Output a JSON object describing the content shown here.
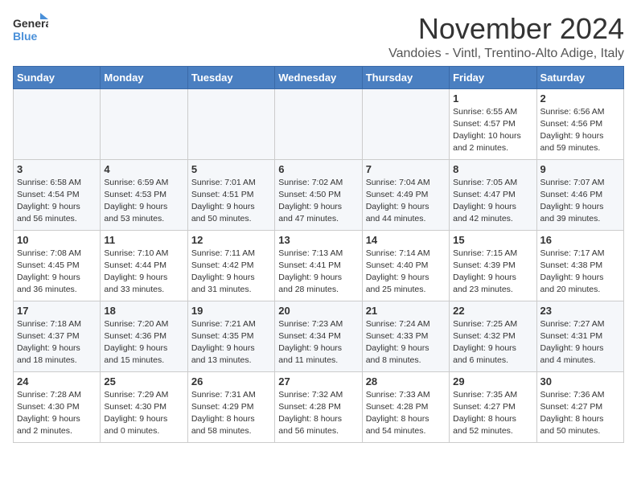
{
  "header": {
    "logo_general": "General",
    "logo_blue": "Blue",
    "month_title": "November 2024",
    "subtitle": "Vandoies - Vintl, Trentino-Alto Adige, Italy"
  },
  "weekdays": [
    "Sunday",
    "Monday",
    "Tuesday",
    "Wednesday",
    "Thursday",
    "Friday",
    "Saturday"
  ],
  "weeks": [
    {
      "days": [
        {
          "date": "",
          "info": ""
        },
        {
          "date": "",
          "info": ""
        },
        {
          "date": "",
          "info": ""
        },
        {
          "date": "",
          "info": ""
        },
        {
          "date": "",
          "info": ""
        },
        {
          "date": "1",
          "info": "Sunrise: 6:55 AM\nSunset: 4:57 PM\nDaylight: 10 hours\nand 2 minutes."
        },
        {
          "date": "2",
          "info": "Sunrise: 6:56 AM\nSunset: 4:56 PM\nDaylight: 9 hours\nand 59 minutes."
        }
      ]
    },
    {
      "days": [
        {
          "date": "3",
          "info": "Sunrise: 6:58 AM\nSunset: 4:54 PM\nDaylight: 9 hours\nand 56 minutes."
        },
        {
          "date": "4",
          "info": "Sunrise: 6:59 AM\nSunset: 4:53 PM\nDaylight: 9 hours\nand 53 minutes."
        },
        {
          "date": "5",
          "info": "Sunrise: 7:01 AM\nSunset: 4:51 PM\nDaylight: 9 hours\nand 50 minutes."
        },
        {
          "date": "6",
          "info": "Sunrise: 7:02 AM\nSunset: 4:50 PM\nDaylight: 9 hours\nand 47 minutes."
        },
        {
          "date": "7",
          "info": "Sunrise: 7:04 AM\nSunset: 4:49 PM\nDaylight: 9 hours\nand 44 minutes."
        },
        {
          "date": "8",
          "info": "Sunrise: 7:05 AM\nSunset: 4:47 PM\nDaylight: 9 hours\nand 42 minutes."
        },
        {
          "date": "9",
          "info": "Sunrise: 7:07 AM\nSunset: 4:46 PM\nDaylight: 9 hours\nand 39 minutes."
        }
      ]
    },
    {
      "days": [
        {
          "date": "10",
          "info": "Sunrise: 7:08 AM\nSunset: 4:45 PM\nDaylight: 9 hours\nand 36 minutes."
        },
        {
          "date": "11",
          "info": "Sunrise: 7:10 AM\nSunset: 4:44 PM\nDaylight: 9 hours\nand 33 minutes."
        },
        {
          "date": "12",
          "info": "Sunrise: 7:11 AM\nSunset: 4:42 PM\nDaylight: 9 hours\nand 31 minutes."
        },
        {
          "date": "13",
          "info": "Sunrise: 7:13 AM\nSunset: 4:41 PM\nDaylight: 9 hours\nand 28 minutes."
        },
        {
          "date": "14",
          "info": "Sunrise: 7:14 AM\nSunset: 4:40 PM\nDaylight: 9 hours\nand 25 minutes."
        },
        {
          "date": "15",
          "info": "Sunrise: 7:15 AM\nSunset: 4:39 PM\nDaylight: 9 hours\nand 23 minutes."
        },
        {
          "date": "16",
          "info": "Sunrise: 7:17 AM\nSunset: 4:38 PM\nDaylight: 9 hours\nand 20 minutes."
        }
      ]
    },
    {
      "days": [
        {
          "date": "17",
          "info": "Sunrise: 7:18 AM\nSunset: 4:37 PM\nDaylight: 9 hours\nand 18 minutes."
        },
        {
          "date": "18",
          "info": "Sunrise: 7:20 AM\nSunset: 4:36 PM\nDaylight: 9 hours\nand 15 minutes."
        },
        {
          "date": "19",
          "info": "Sunrise: 7:21 AM\nSunset: 4:35 PM\nDaylight: 9 hours\nand 13 minutes."
        },
        {
          "date": "20",
          "info": "Sunrise: 7:23 AM\nSunset: 4:34 PM\nDaylight: 9 hours\nand 11 minutes."
        },
        {
          "date": "21",
          "info": "Sunrise: 7:24 AM\nSunset: 4:33 PM\nDaylight: 9 hours\nand 8 minutes."
        },
        {
          "date": "22",
          "info": "Sunrise: 7:25 AM\nSunset: 4:32 PM\nDaylight: 9 hours\nand 6 minutes."
        },
        {
          "date": "23",
          "info": "Sunrise: 7:27 AM\nSunset: 4:31 PM\nDaylight: 9 hours\nand 4 minutes."
        }
      ]
    },
    {
      "days": [
        {
          "date": "24",
          "info": "Sunrise: 7:28 AM\nSunset: 4:30 PM\nDaylight: 9 hours\nand 2 minutes."
        },
        {
          "date": "25",
          "info": "Sunrise: 7:29 AM\nSunset: 4:30 PM\nDaylight: 9 hours\nand 0 minutes."
        },
        {
          "date": "26",
          "info": "Sunrise: 7:31 AM\nSunset: 4:29 PM\nDaylight: 8 hours\nand 58 minutes."
        },
        {
          "date": "27",
          "info": "Sunrise: 7:32 AM\nSunset: 4:28 PM\nDaylight: 8 hours\nand 56 minutes."
        },
        {
          "date": "28",
          "info": "Sunrise: 7:33 AM\nSunset: 4:28 PM\nDaylight: 8 hours\nand 54 minutes."
        },
        {
          "date": "29",
          "info": "Sunrise: 7:35 AM\nSunset: 4:27 PM\nDaylight: 8 hours\nand 52 minutes."
        },
        {
          "date": "30",
          "info": "Sunrise: 7:36 AM\nSunset: 4:27 PM\nDaylight: 8 hours\nand 50 minutes."
        }
      ]
    }
  ]
}
